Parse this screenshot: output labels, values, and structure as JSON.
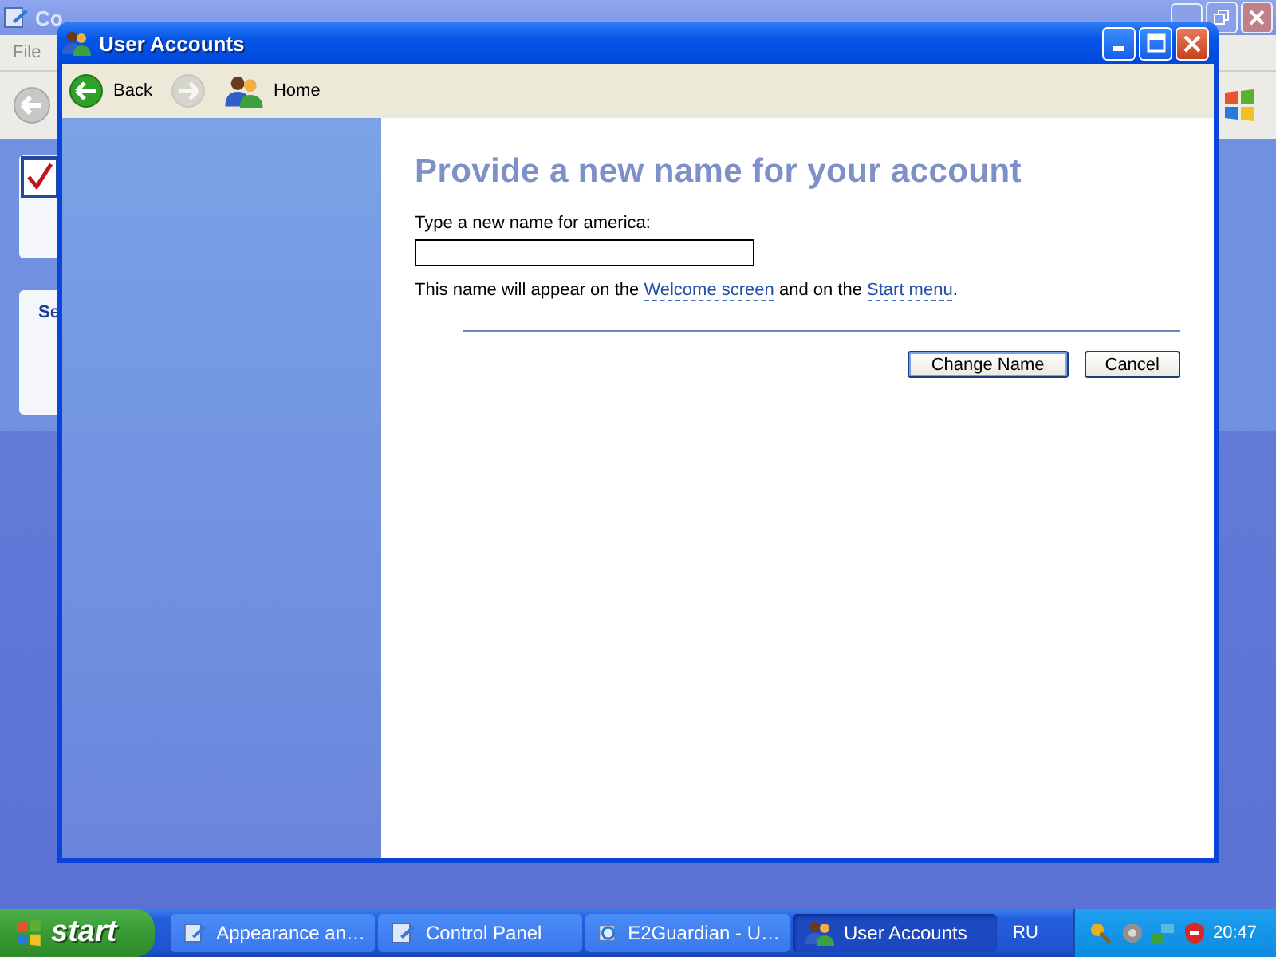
{
  "background_window": {
    "title": "Co",
    "menu": [
      "File"
    ],
    "panel_heading": "Se"
  },
  "window": {
    "title": "User Accounts"
  },
  "toolbar": [
    {
      "kind": "back",
      "label": "Back",
      "disabled": false
    },
    {
      "kind": "forward",
      "disabled": true
    },
    {
      "kind": "home",
      "label": "Home",
      "disabled": false
    }
  ],
  "content": {
    "heading": "Provide a new name for your account",
    "field_label": "Type a new name for america:",
    "note": [
      {
        "kind": "text",
        "text": "This name will appear on the "
      },
      {
        "kind": "link",
        "text": "Welcome screen"
      },
      {
        "kind": "text",
        "text": " and on the "
      },
      {
        "kind": "link",
        "text": "Start menu"
      },
      {
        "kind": "text",
        "text": "."
      }
    ],
    "buttons": [
      {
        "label": "Change Name",
        "default": true
      },
      {
        "label": "Cancel",
        "default": false
      }
    ]
  },
  "taskbar": {
    "start": "start",
    "tasks": [
      {
        "label": "Appearance an…",
        "kind": "folder",
        "selected": false
      },
      {
        "label": "Control Panel",
        "kind": "folder",
        "selected": false
      },
      {
        "label": "E2Guardian - U…",
        "kind": "browser",
        "selected": false
      },
      {
        "label": "User Accounts",
        "kind": "users",
        "selected": true
      }
    ],
    "language": "RU",
    "clock": "20:47"
  }
}
